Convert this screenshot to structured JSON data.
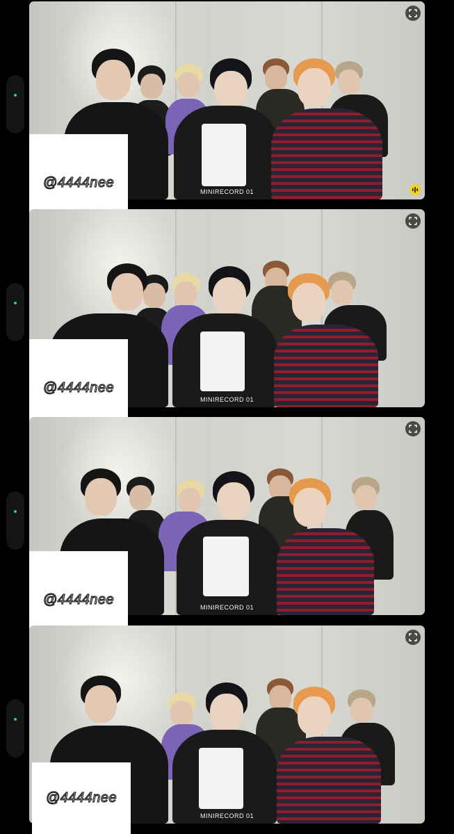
{
  "frames": [
    {
      "caption": "MINIRECORD 01",
      "watermark": "@4444nee",
      "fullscreen_icon": "fullscreen-icon",
      "audio_icon": "audio-wave-icon"
    },
    {
      "caption": "MINIRECORD 01",
      "watermark": "@4444nee",
      "fullscreen_icon": "fullscreen-icon"
    },
    {
      "caption": "MINIRECORD 01",
      "watermark": "@4444nee",
      "fullscreen_icon": "fullscreen-icon"
    },
    {
      "caption": "MINIRECORD 01",
      "watermark": "@4444nee",
      "fullscreen_icon": "fullscreen-icon"
    }
  ],
  "colors": {
    "background": "#000000",
    "indicator": "#2fd36a",
    "audio_badge": "#f2d21b"
  }
}
